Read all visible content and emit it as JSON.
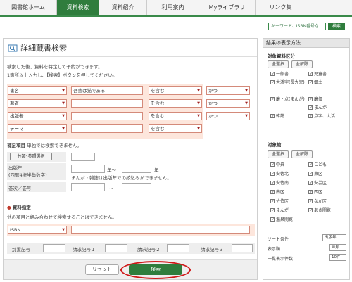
{
  "nav": {
    "tabs": [
      {
        "label": "図書館ホーム"
      },
      {
        "label": "資料検索"
      },
      {
        "label": "資料紹介"
      },
      {
        "label": "利用案内"
      },
      {
        "label": "Myライブラリ"
      },
      {
        "label": "リンク集"
      }
    ]
  },
  "keyword": {
    "placeholder": "キーワード、ISBN番号な",
    "button": "検索"
  },
  "main": {
    "title": "詳細蔵書検索",
    "note1": "検索した後、資料を特定して予約ができます。",
    "note2": "1箇所以上入力し、【検索】ボタンを押してください。",
    "rows": [
      {
        "field": "書名",
        "value": "吾輩は猫である",
        "match": "を含む",
        "op": "かつ"
      },
      {
        "field": "著者",
        "value": "",
        "match": "を含む",
        "op": "かつ"
      },
      {
        "field": "出版者",
        "value": "",
        "match": "を含む",
        "op": "かつ"
      },
      {
        "field": "テーマ",
        "value": "",
        "match": "を含む",
        "op": ""
      }
    ],
    "supplement_label": "補足項目",
    "supplement_note": "単独では検索できません。",
    "classify_btn": "分類･参照選択",
    "pubyear_label1": "出版年",
    "pubyear_label2": "(西暦4桁半角数字)",
    "year_from": "年～",
    "year_to": "年",
    "pubyear_note": "まんが・雑誌は出版年での絞込みができません。",
    "volume_label": "巻次／巻号",
    "volume_sep": "～",
    "resource_label": "資料指定",
    "resource_note": "他の項目と組み合わせて検索することはできません。",
    "resource_type": "ISBN",
    "call_labels": [
      "別置記号",
      "請求記号１",
      "請求記号２",
      "請求記号３"
    ],
    "reset": "リセット",
    "search": "検索"
  },
  "side": {
    "title": "結果の表示方法",
    "material_label": "対象資料区分",
    "select_all": "全選択",
    "deselect_all": "全解除",
    "materials": [
      "一般書",
      "児童書",
      "大活字(長大児)",
      "郷土",
      "廉・点(まんが)",
      "廉価",
      "雑誌",
      "まんが",
      "点字、大活"
    ],
    "library_label": "対象館",
    "libraries": [
      "中央",
      "こども",
      "安佐北",
      "東区",
      "安佐南",
      "安芸区",
      "南区",
      "西区",
      "佐伯区",
      "なか区",
      "まんが",
      "あさ閲覧",
      "温泉閲覧"
    ],
    "sort_label": "ソート条件",
    "sort_value": "出版年",
    "order_label": "表示順",
    "order_value": "降順",
    "count_label": "一覧表示件数",
    "count_value": "10件"
  }
}
